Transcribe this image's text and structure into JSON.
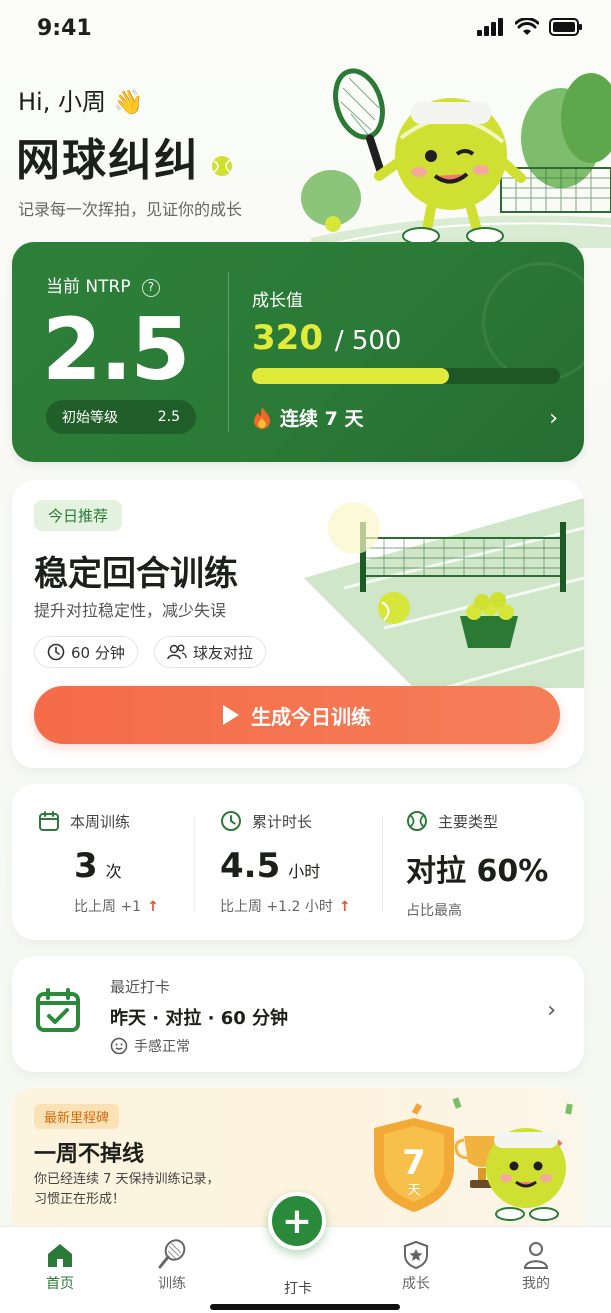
{
  "status_bar": {
    "time": "9:41"
  },
  "hero": {
    "greeting": "Hi, 小周 👋",
    "app_title": "网球纠纠",
    "tagline": "记录每一次挥拍，见证你的成长"
  },
  "ntrp": {
    "label": "当前 NTRP",
    "value": "2.5",
    "initial_label": "初始等级",
    "initial_value": "2.5",
    "growth_label": "成长值",
    "growth_current": "320",
    "growth_max": "/ 500",
    "growth_progress": 0.64,
    "streak_text": "连续 7 天"
  },
  "today": {
    "badge": "今日推荐",
    "title": "稳定回合训练",
    "subtitle": "提升对拉稳定性，减少失误",
    "duration": "60 分钟",
    "mode": "球友对拉",
    "button": "生成今日训练"
  },
  "stats": [
    {
      "label": "本周训练",
      "value": "3",
      "unit": "次",
      "foot": "比上周 +1",
      "trend": "↑"
    },
    {
      "label": "累计时长",
      "value": "4.5",
      "unit": "小时",
      "foot": "比上周 +1.2 小时",
      "trend": "↑"
    },
    {
      "label": "主要类型",
      "value": "对拉 60%",
      "unit": "",
      "foot": "占比最高",
      "trend": ""
    }
  ],
  "checkin": {
    "label": "最近打卡",
    "main": "昨天 · 对拉 · 60 分钟",
    "feeling": "手感正常"
  },
  "milestone": {
    "badge": "最新里程碑",
    "title": "一周不掉线",
    "desc_line1": "你已经连续 7 天保持训练记录，",
    "desc_line2": "习惯正在形成！",
    "shield_number": "7",
    "shield_unit": "天"
  },
  "tabbar": {
    "home": "首页",
    "training": "训练",
    "checkin": "打卡",
    "growth": "成长",
    "me": "我的"
  },
  "colors": {
    "brand_green": "#2b7a37",
    "accent_orange": "#f56b49",
    "ball_yellow": "#e0ea3a"
  }
}
